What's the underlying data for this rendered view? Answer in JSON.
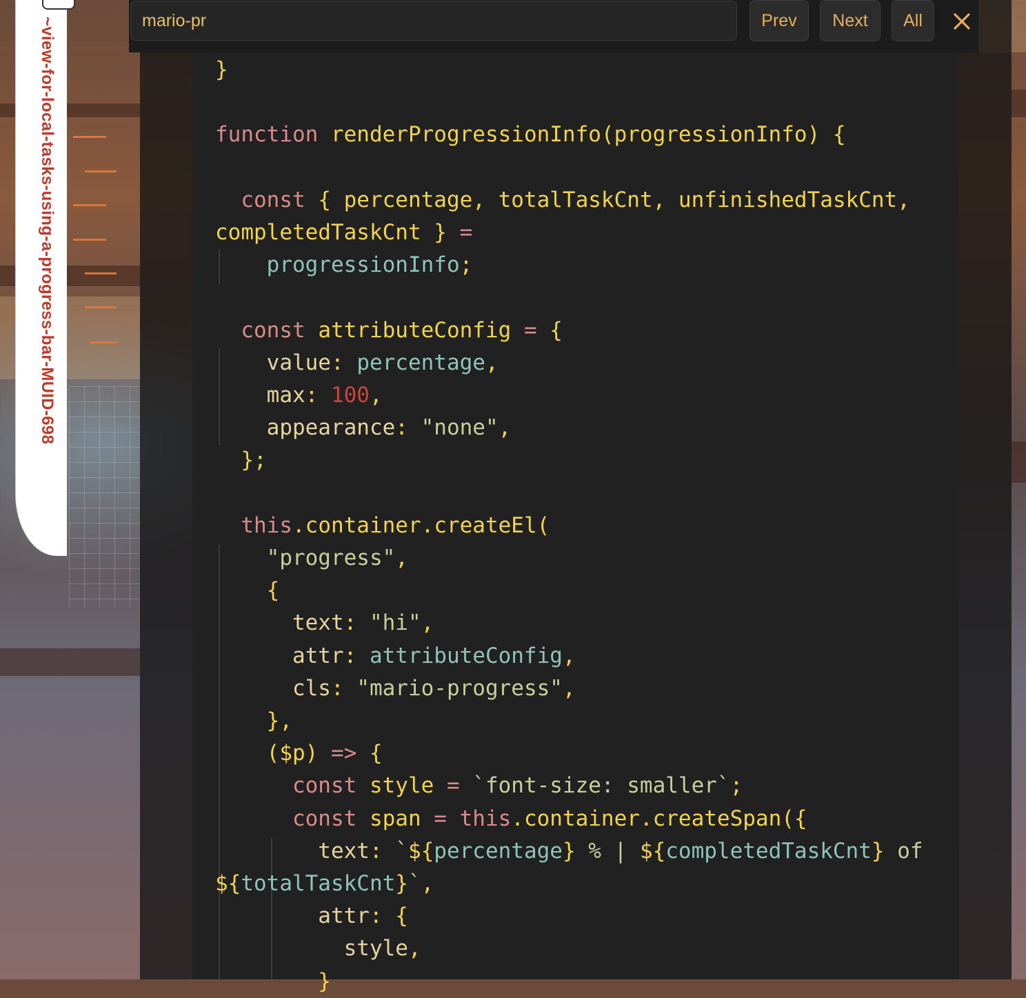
{
  "search": {
    "value": "mario-pr",
    "prev_label": "Prev",
    "next_label": "Next",
    "all_label": "All"
  },
  "sidebar_tab": {
    "label": "~view-for-local-tasks-using-a-progress-bar-MUID-698"
  },
  "colors": {
    "keyword": "#d98a8a",
    "function_name": "#f2d34f",
    "reference": "#8fc4b8",
    "string": "#c7cf9a",
    "number": "#d0433a",
    "accent": "#e6b15e"
  },
  "code": {
    "lines": [
      [
        {
          "t": "}",
          "c": "pu"
        }
      ],
      [],
      [
        {
          "t": "function ",
          "c": "kw"
        },
        {
          "t": "renderProgressionInfo",
          "c": "fn"
        },
        {
          "t": "(",
          "c": "pu"
        },
        {
          "t": "progressionInfo",
          "c": "vr"
        },
        {
          "t": ") {",
          "c": "pu"
        }
      ],
      [],
      [
        {
          "t": "  const ",
          "c": "kw"
        },
        {
          "t": "{ ",
          "c": "pu"
        },
        {
          "t": "percentage",
          "c": "vr"
        },
        {
          "t": ", ",
          "c": "pu"
        },
        {
          "t": "totalTaskCnt",
          "c": "vr"
        },
        {
          "t": ", ",
          "c": "pu"
        },
        {
          "t": "unfinishedTaskCnt",
          "c": "vr"
        },
        {
          "t": ",",
          "c": "pu"
        }
      ],
      [
        {
          "t": "completedTaskCnt",
          "c": "vr"
        },
        {
          "t": " } ",
          "c": "pu"
        },
        {
          "t": "=",
          "c": "op"
        }
      ],
      [
        {
          "t": "    ",
          "c": "pu"
        },
        {
          "t": "progressionInfo",
          "c": "rf"
        },
        {
          "t": ";",
          "c": "pu"
        }
      ],
      [],
      [
        {
          "t": "  const ",
          "c": "kw"
        },
        {
          "t": "attributeConfig",
          "c": "vr"
        },
        {
          "t": " = ",
          "c": "op"
        },
        {
          "t": "{",
          "c": "pu"
        }
      ],
      [
        {
          "t": "    value",
          "c": "pr"
        },
        {
          "t": ": ",
          "c": "pu"
        },
        {
          "t": "percentage",
          "c": "rf"
        },
        {
          "t": ",",
          "c": "pu"
        }
      ],
      [
        {
          "t": "    max",
          "c": "pr"
        },
        {
          "t": ": ",
          "c": "pu"
        },
        {
          "t": "100",
          "c": "nm"
        },
        {
          "t": ",",
          "c": "pu"
        }
      ],
      [
        {
          "t": "    appearance",
          "c": "pr"
        },
        {
          "t": ": ",
          "c": "pu"
        },
        {
          "t": "\"none\"",
          "c": "st"
        },
        {
          "t": ",",
          "c": "pu"
        }
      ],
      [
        {
          "t": "  };",
          "c": "pu"
        }
      ],
      [],
      [
        {
          "t": "  this",
          "c": "th"
        },
        {
          "t": ".",
          "c": "pu"
        },
        {
          "t": "container",
          "c": "me"
        },
        {
          "t": ".",
          "c": "pu"
        },
        {
          "t": "createEl",
          "c": "me"
        },
        {
          "t": "(",
          "c": "pu"
        }
      ],
      [
        {
          "t": "    ",
          "c": "pu"
        },
        {
          "t": "\"progress\"",
          "c": "st"
        },
        {
          "t": ",",
          "c": "pu"
        }
      ],
      [
        {
          "t": "    {",
          "c": "pu"
        }
      ],
      [
        {
          "t": "      text",
          "c": "pr"
        },
        {
          "t": ": ",
          "c": "pu"
        },
        {
          "t": "\"hi\"",
          "c": "st"
        },
        {
          "t": ",",
          "c": "pu"
        }
      ],
      [
        {
          "t": "      attr",
          "c": "pr"
        },
        {
          "t": ": ",
          "c": "pu"
        },
        {
          "t": "attributeConfig",
          "c": "rf"
        },
        {
          "t": ",",
          "c": "pu"
        }
      ],
      [
        {
          "t": "      cls",
          "c": "pr"
        },
        {
          "t": ": ",
          "c": "pu"
        },
        {
          "t": "\"mario-progress\"",
          "c": "st"
        },
        {
          "t": ",",
          "c": "pu"
        }
      ],
      [
        {
          "t": "    },",
          "c": "pu"
        }
      ],
      [
        {
          "t": "    ($p) ",
          "c": "pu"
        },
        {
          "t": "=>",
          "c": "op"
        },
        {
          "t": " {",
          "c": "pu"
        }
      ],
      [
        {
          "t": "      const ",
          "c": "kw"
        },
        {
          "t": "style",
          "c": "vr"
        },
        {
          "t": " = ",
          "c": "op"
        },
        {
          "t": "`font-size: smaller`",
          "c": "st"
        },
        {
          "t": ";",
          "c": "pu"
        }
      ],
      [
        {
          "t": "      const ",
          "c": "kw"
        },
        {
          "t": "span",
          "c": "vr"
        },
        {
          "t": " = ",
          "c": "op"
        },
        {
          "t": "this",
          "c": "th"
        },
        {
          "t": ".",
          "c": "pu"
        },
        {
          "t": "container",
          "c": "me"
        },
        {
          "t": ".",
          "c": "pu"
        },
        {
          "t": "createSpan",
          "c": "me"
        },
        {
          "t": "({",
          "c": "pu"
        }
      ],
      [
        {
          "t": "        text",
          "c": "pr"
        },
        {
          "t": ": ",
          "c": "pu"
        },
        {
          "t": "`",
          "c": "st"
        },
        {
          "t": "${",
          "c": "pu"
        },
        {
          "t": "percentage",
          "c": "rf"
        },
        {
          "t": "}",
          "c": "pu"
        },
        {
          "t": " % | ",
          "c": "st"
        },
        {
          "t": "${",
          "c": "pu"
        },
        {
          "t": "completedTaskCnt",
          "c": "rf"
        },
        {
          "t": "}",
          "c": "pu"
        },
        {
          "t": " of",
          "c": "st"
        }
      ],
      [
        {
          "t": "${",
          "c": "pu"
        },
        {
          "t": "totalTaskCnt",
          "c": "rf"
        },
        {
          "t": "}",
          "c": "pu"
        },
        {
          "t": "`",
          "c": "st"
        },
        {
          "t": ",",
          "c": "pu"
        }
      ],
      [
        {
          "t": "        attr",
          "c": "pr"
        },
        {
          "t": ": ",
          "c": "pu"
        },
        {
          "t": "{",
          "c": "pu"
        }
      ],
      [
        {
          "t": "          style",
          "c": "pr"
        },
        {
          "t": ",",
          "c": "pu"
        }
      ],
      [
        {
          "t": "        }",
          "c": "pu"
        }
      ]
    ]
  }
}
